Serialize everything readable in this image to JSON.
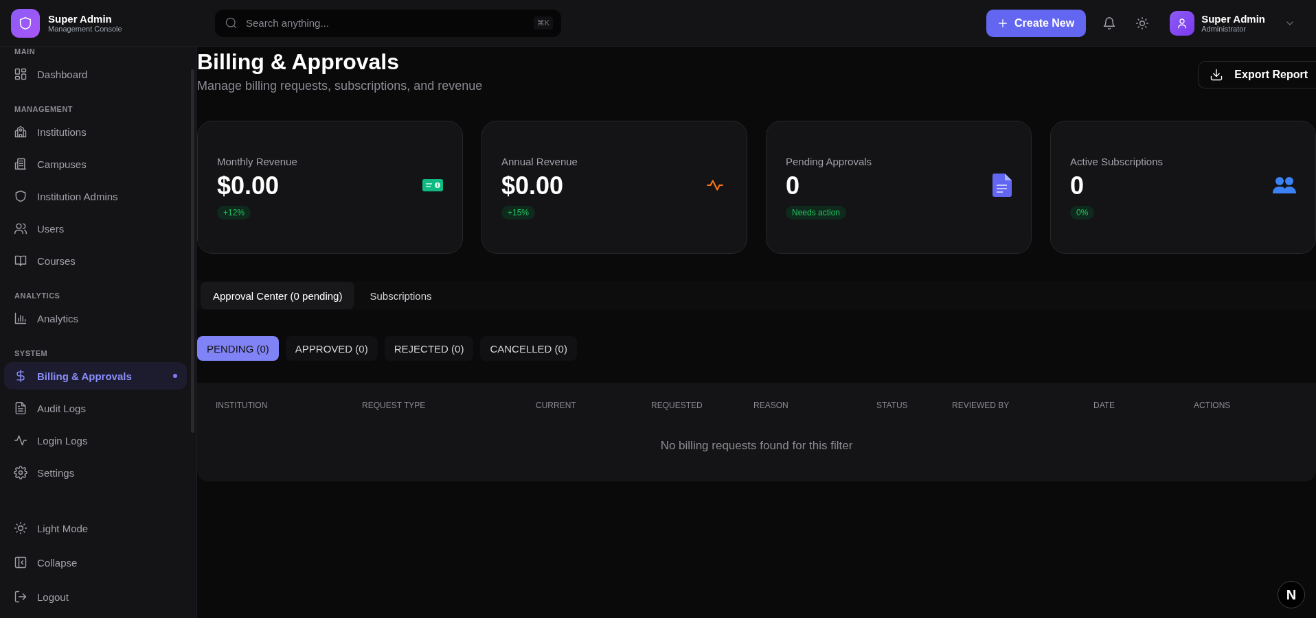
{
  "brand": {
    "title": "Super Admin",
    "subtitle": "Management Console"
  },
  "search": {
    "placeholder": "Search anything...",
    "shortcut": "⌘K"
  },
  "header": {
    "create_button": "Create New",
    "user": {
      "name": "Super Admin",
      "role": "Administrator"
    }
  },
  "sidebar": {
    "sections": [
      {
        "label": "MAIN",
        "items": [
          {
            "label": "Dashboard",
            "selected": false
          }
        ]
      },
      {
        "label": "MANAGEMENT",
        "items": [
          {
            "label": "Institutions",
            "selected": false
          },
          {
            "label": "Campuses",
            "selected": false
          },
          {
            "label": "Institution Admins",
            "selected": false
          },
          {
            "label": "Users",
            "selected": false
          },
          {
            "label": "Courses",
            "selected": false
          }
        ]
      },
      {
        "label": "ANALYTICS",
        "items": [
          {
            "label": "Analytics",
            "selected": false
          }
        ]
      },
      {
        "label": "SYSTEM",
        "items": [
          {
            "label": "Billing & Approvals",
            "selected": true
          },
          {
            "label": "Audit Logs",
            "selected": false
          },
          {
            "label": "Login Logs",
            "selected": false
          },
          {
            "label": "Settings",
            "selected": false
          }
        ]
      }
    ],
    "footer_items": [
      "Light Mode",
      "Collapse",
      "Logout"
    ]
  },
  "page": {
    "title": "Billing & Approvals",
    "subtitle": "Manage billing requests, subscriptions, and revenue",
    "export_button": "Export Report"
  },
  "stats": [
    {
      "label": "Monthly Revenue",
      "value": "$0.00",
      "badge": "+12%",
      "kind": "money",
      "color": "#10b981"
    },
    {
      "label": "Annual Revenue",
      "value": "$0.00",
      "badge": "+15%",
      "kind": "pulse",
      "color": "#f97316"
    },
    {
      "label": "Pending Approvals",
      "value": "0",
      "badge": "Needs action",
      "kind": "document",
      "color": "#6366f1"
    },
    {
      "label": "Active Subscriptions",
      "value": "0",
      "badge": "0%",
      "kind": "people",
      "color": "#3b82f6"
    }
  ],
  "tabs": [
    {
      "label": "Approval Center (0 pending)",
      "selected": true
    },
    {
      "label": "Subscriptions",
      "selected": false
    }
  ],
  "filters": [
    {
      "label": "PENDING (0)",
      "selected": true
    },
    {
      "label": "APPROVED (0)",
      "selected": false
    },
    {
      "label": "REJECTED (0)",
      "selected": false
    },
    {
      "label": "CANCELLED (0)",
      "selected": false
    }
  ],
  "table": {
    "columns": [
      "INSTITUTION",
      "REQUEST TYPE",
      "CURRENT",
      "REQUESTED",
      "REASON",
      "STATUS",
      "REVIEWED BY",
      "DATE",
      "ACTIONS"
    ],
    "empty_message": "No billing requests found for this filter"
  },
  "dev_badge": "N"
}
